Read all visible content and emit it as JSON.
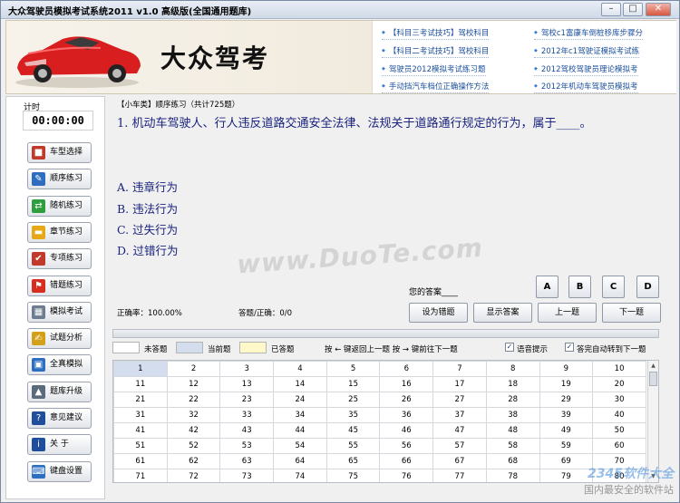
{
  "window": {
    "title": "大众驾驶员模拟考试系统2011 v1.0 高级版(全国通用题库)"
  },
  "banner": {
    "brand": "大众驾考",
    "links": [
      "【科目三考试技巧】驾校科目",
      "驾校c1富康车倒桩移库步骤分",
      "【科目二考试技巧】驾校科目",
      "2012年c1驾驶证模拟考试练",
      "驾驶员2012模拟考试练习题",
      "2012驾校驾驶员理论模拟考",
      "手动挡汽车档位正确操作方法",
      "2012年机动车驾驶员模拟考"
    ]
  },
  "timer": {
    "label": "计时",
    "value": "00:00:00"
  },
  "sidebar": {
    "buttons": [
      {
        "label": "车型选择",
        "icon": "car-type-icon",
        "color": "#c0392b"
      },
      {
        "label": "顺序练习",
        "icon": "pencil-icon",
        "color": "#2e6ec1"
      },
      {
        "label": "随机练习",
        "icon": "shuffle-icon",
        "color": "#2e9e3e"
      },
      {
        "label": "章节练习",
        "icon": "folder-icon",
        "color": "#e6a817"
      },
      {
        "label": "专项练习",
        "icon": "checklist-icon",
        "color": "#c0392b"
      },
      {
        "label": "错题练习",
        "icon": "flag-icon",
        "color": "#d62d20"
      },
      {
        "label": "模拟考试",
        "icon": "calculator-icon",
        "color": "#6d7d8f"
      },
      {
        "label": "试题分析",
        "icon": "notepad-icon",
        "color": "#d4a017"
      },
      {
        "label": "全真模拟",
        "icon": "window-icon",
        "color": "#2e6ec1"
      },
      {
        "label": "题库升级",
        "icon": "upgrade-icon",
        "color": "#5a6b7d"
      },
      {
        "label": "意见建议",
        "icon": "help-icon",
        "color": "#1f4e9c"
      },
      {
        "label": "关    于",
        "icon": "info-icon",
        "color": "#1f4e9c"
      },
      {
        "label": "键盘设置",
        "icon": "keyboard-icon",
        "color": "#2e6ec1"
      }
    ]
  },
  "question": {
    "meta": "【小车类】顺序练习（共计725题）",
    "text": "1. 机动车驾驶人、行人违反道路交通安全法律、法规关于道路通行规定的行为，属于____。",
    "options": [
      "A. 违章行为",
      "B. 违法行为",
      "C. 过失行为",
      "D. 过错行为"
    ]
  },
  "answer": {
    "label": "您的答案____",
    "choices": [
      "A",
      "B",
      "C",
      "D"
    ]
  },
  "stats": {
    "accuracy": "正确率：100.00%",
    "answered": "答题/正确：0/0"
  },
  "actions": {
    "mark_wrong": "设为错题",
    "show_answer": "显示答案",
    "prev": "上一题",
    "next": "下一题"
  },
  "watermark": "www.DuoTe.com",
  "legend": {
    "unanswered": "未答题",
    "current": "当前题",
    "answered": "已答题",
    "hint": "按 ← 键返回上一题  按 → 键前往下一题",
    "voice": "语音提示",
    "auto_next": "答完自动转到下一题"
  },
  "colors": {
    "unanswered": "#ffffff",
    "current": "#d3ddee",
    "answered": "#fff8c8"
  },
  "grid": {
    "rows": [
      [
        "1",
        "2",
        "3",
        "4",
        "5",
        "6",
        "7",
        "8",
        "9",
        "10"
      ],
      [
        "11",
        "12",
        "13",
        "14",
        "15",
        "16",
        "17",
        "18",
        "19",
        "20"
      ],
      [
        "21",
        "22",
        "23",
        "24",
        "25",
        "26",
        "27",
        "28",
        "29",
        "30"
      ],
      [
        "31",
        "32",
        "33",
        "34",
        "35",
        "36",
        "37",
        "38",
        "39",
        "40"
      ],
      [
        "41",
        "42",
        "43",
        "44",
        "45",
        "46",
        "47",
        "48",
        "49",
        "50"
      ],
      [
        "51",
        "52",
        "53",
        "54",
        "55",
        "56",
        "57",
        "58",
        "59",
        "60"
      ],
      [
        "61",
        "62",
        "63",
        "64",
        "65",
        "66",
        "67",
        "68",
        "69",
        "70"
      ],
      [
        "71",
        "72",
        "73",
        "74",
        "75",
        "76",
        "77",
        "78",
        "79",
        "80"
      ]
    ]
  },
  "corner_logo": {
    "line1": "2345软件大全",
    "line2": "国内最安全的软件站"
  }
}
